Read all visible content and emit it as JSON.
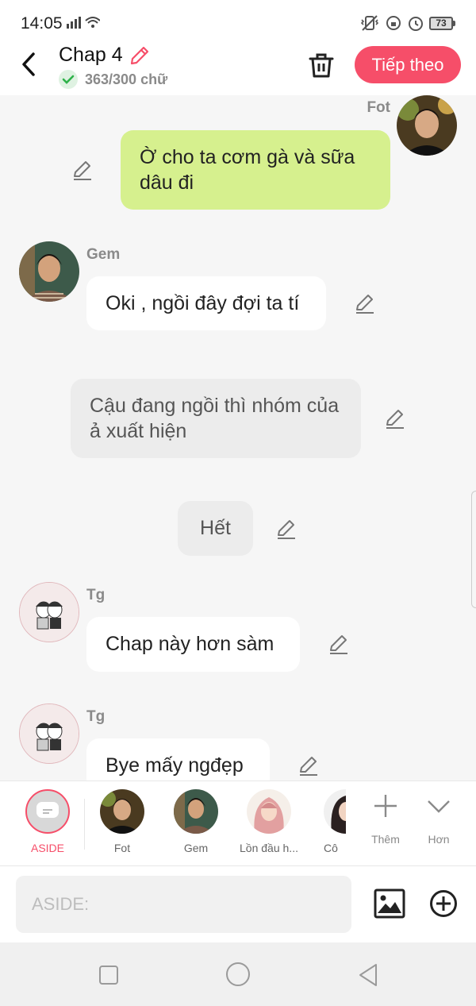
{
  "status_bar": {
    "time": "14:05",
    "battery": "73"
  },
  "header": {
    "title": "Chap 4",
    "word_count": "363/300 chữ",
    "next_label": "Tiếp theo"
  },
  "messages": [
    {
      "sender": "Fot",
      "side": "right",
      "text": "Ờ cho ta cơm gà và sữa dâu đi",
      "style": "green"
    },
    {
      "sender": "Gem",
      "side": "left",
      "text": "Oki , ngồi đây đợi ta tí",
      "style": "white"
    },
    {
      "sender": "",
      "side": "center",
      "text": "Cậu đang ngồi thì nhóm của ả xuất hiện",
      "style": "grey"
    },
    {
      "sender": "",
      "side": "center",
      "text": "Hết",
      "style": "grey"
    },
    {
      "sender": "Tg",
      "side": "left",
      "text": "Chap này hơn sàm",
      "style": "white"
    },
    {
      "sender": "Tg",
      "side": "left",
      "text": "Bye mấy ngđẹp",
      "style": "white"
    }
  ],
  "characters": [
    {
      "label": "ASIDE",
      "selected": true
    },
    {
      "label": "Fot"
    },
    {
      "label": "Gem"
    },
    {
      "label": "Lồn đầu h..."
    },
    {
      "label": "Cô"
    }
  ],
  "tools": {
    "add_label": "Thêm",
    "more_label": "Hơn"
  },
  "input": {
    "placeholder": "ASIDE:"
  },
  "colors": {
    "accent": "#f64e69",
    "bubble_green": "#d6f08e",
    "bubble_grey": "#ececec"
  }
}
